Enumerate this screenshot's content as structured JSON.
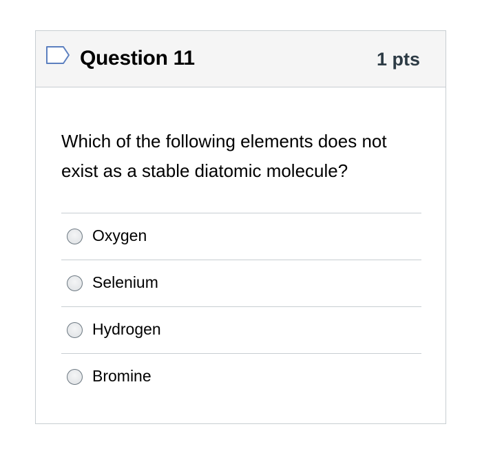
{
  "question": {
    "title": "Question 11",
    "points": "1 pts",
    "flag_icon": "flag-outline-icon",
    "text": "Which of the following elements does not exist as a stable diatomic molecule?",
    "answers": [
      {
        "label": "Oxygen",
        "selected": false
      },
      {
        "label": "Selenium",
        "selected": false
      },
      {
        "label": "Hydrogen",
        "selected": false
      },
      {
        "label": "Bromine",
        "selected": false
      }
    ]
  },
  "colors": {
    "header_bg": "#f5f5f5",
    "border": "#c7cdd1",
    "flag_stroke": "#5b7fbf",
    "text": "#000000"
  }
}
